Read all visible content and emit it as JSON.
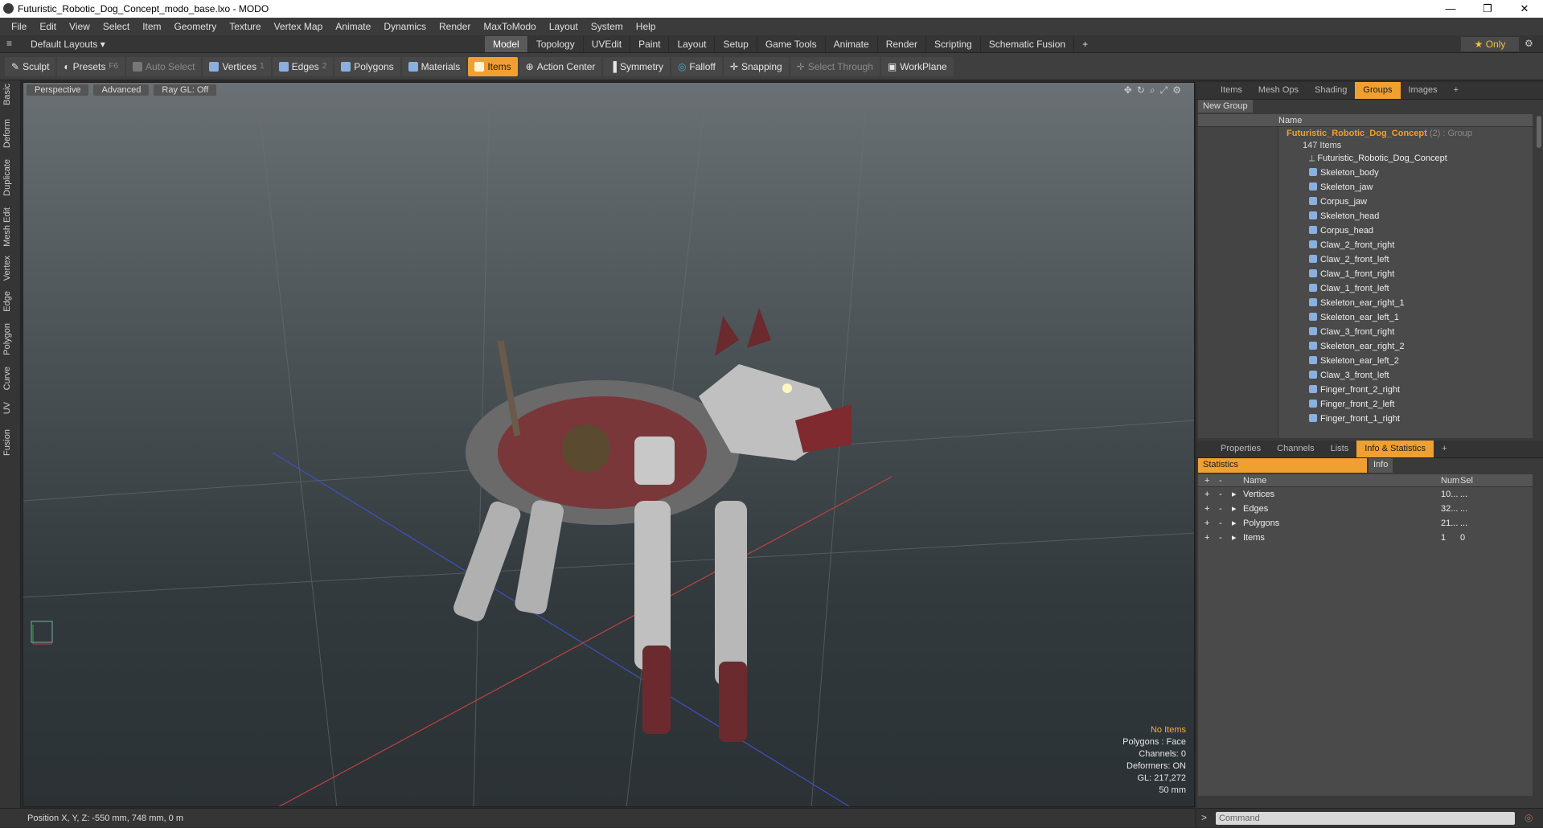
{
  "window": {
    "title": "Futuristic_Robotic_Dog_Concept_modo_base.lxo - MODO",
    "controls": [
      "—",
      "❐",
      "✕"
    ]
  },
  "menu": [
    "File",
    "Edit",
    "View",
    "Select",
    "Item",
    "Geometry",
    "Texture",
    "Vertex Map",
    "Animate",
    "Dynamics",
    "Render",
    "MaxToModo",
    "Layout",
    "System",
    "Help"
  ],
  "layout": {
    "default_layouts": "Default Layouts ▾",
    "tabs": [
      "Model",
      "Topology",
      "UVEdit",
      "Paint",
      "Layout",
      "Setup",
      "Game Tools",
      "Animate",
      "Render",
      "Scripting",
      "Schematic Fusion"
    ],
    "active_tab": "Model",
    "plus": "+",
    "only": "★ Only"
  },
  "toolbar": {
    "sculpt": "Sculpt",
    "presets": "Presets",
    "presets_key": "F6",
    "auto_select": "Auto Select",
    "vertices": "Vertices",
    "vertices_key": "1",
    "edges": "Edges",
    "edges_key": "2",
    "polygons": "Polygons",
    "materials": "Materials",
    "items": "Items",
    "action_center": "Action Center",
    "symmetry": "Symmetry",
    "falloff": "Falloff",
    "snapping": "Snapping",
    "select_through": "Select Through",
    "workplane": "WorkPlane"
  },
  "left_tabs": [
    "Basic",
    "Deform",
    "Duplicate",
    "Mesh Edit",
    "Vertex",
    "Edge",
    "Polygon",
    "Curve",
    "UV",
    "Fusion"
  ],
  "viewport": {
    "perspective": "Perspective",
    "advanced": "Advanced",
    "raygl": "Ray GL: Off",
    "hud": {
      "no_items": "No Items",
      "polygons": "Polygons : Face",
      "channels": "Channels: 0",
      "deformers": "Deformers: ON",
      "gl": "GL: 217,272",
      "scale": "50 mm"
    }
  },
  "status": "Position X, Y, Z:  -550 mm, 748 mm, 0 m",
  "groups_panel": {
    "tabs": [
      "Items",
      "Mesh Ops",
      "Shading",
      "Groups",
      "Images"
    ],
    "active": "Groups",
    "new_group": "New Group",
    "name_header": "Name",
    "group_name": "Futuristic_Robotic_Dog_Concept",
    "group_suffix": "(2) : Group",
    "count": "147 Items",
    "items": [
      "Futuristic_Robotic_Dog_Concept",
      "Skeleton_body",
      "Skeleton_jaw",
      "Corpus_jaw",
      "Skeleton_head",
      "Corpus_head",
      "Claw_2_front_right",
      "Claw_2_front_left",
      "Claw_1_front_right",
      "Claw_1_front_left",
      "Skeleton_ear_right_1",
      "Skeleton_ear_left_1",
      "Claw_3_front_right",
      "Skeleton_ear_right_2",
      "Skeleton_ear_left_2",
      "Claw_3_front_left",
      "Finger_front_2_right",
      "Finger_front_2_left",
      "Finger_front_1_right"
    ]
  },
  "stats_panel": {
    "tabs": [
      "Properties",
      "Channels",
      "Lists",
      "Info & Statistics"
    ],
    "active": "Info & Statistics",
    "sub_tabs": [
      "Statistics",
      "Info"
    ],
    "headers": {
      "name": "Name",
      "num": "Num",
      "sel": "Sel"
    },
    "rows": [
      {
        "name": "Vertices",
        "num": "10...",
        "sel": "..."
      },
      {
        "name": "Edges",
        "num": "32...",
        "sel": "..."
      },
      {
        "name": "Polygons",
        "num": "21...",
        "sel": "..."
      },
      {
        "name": "Items",
        "num": "1",
        "sel": "0"
      }
    ],
    "command_placeholder": "Command"
  },
  "colors": {
    "accent": "#f0a030",
    "x_axis": "#c04040",
    "z_axis": "#4050c0"
  }
}
